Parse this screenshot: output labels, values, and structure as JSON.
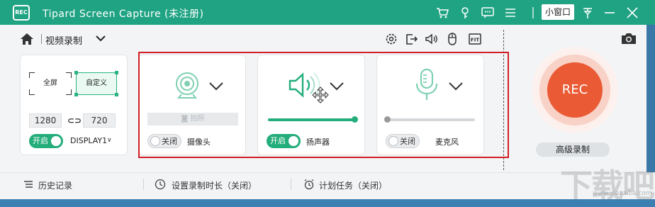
{
  "titlebar": {
    "logo_text": "REC",
    "title": "Tipard Screen Capture (未注册)",
    "mini_window": "小窗口",
    "icons": [
      "cart-icon",
      "key-icon",
      "chat-icon",
      "menu-icon",
      "pin-icon",
      "minimize-icon",
      "close-icon"
    ]
  },
  "toolbar": {
    "mode": "视频录制",
    "tool_icons": [
      "settings-icon",
      "export-icon",
      "volume-icon",
      "mouse-icon",
      "fit-icon"
    ]
  },
  "screen": {
    "full": "全屏",
    "custom": "自定义",
    "width": "1280",
    "height": "720",
    "toggle": "开启",
    "display": "DISPLAY1"
  },
  "camera": {
    "photo": "拍照",
    "toggle": "关闭",
    "label": "摄像头"
  },
  "speaker": {
    "toggle": "开启",
    "label": "扬声器",
    "volume": 1.0
  },
  "microphone": {
    "toggle": "关闭",
    "label": "麦克风",
    "volume": 0.0
  },
  "rec": {
    "label": "REC",
    "advanced": "高级录制"
  },
  "bottom": {
    "history": "历史记录",
    "duration": "设置录制时长（关闭）",
    "schedule": "计划任务（关闭）"
  },
  "colors": {
    "brand": "#1fa383",
    "accent": "#23ad7b",
    "rec": "#ea5a34",
    "highlight": "#d21e25"
  },
  "watermark": {
    "big": "下载吧",
    "small": "www.xiazaiba.com"
  }
}
